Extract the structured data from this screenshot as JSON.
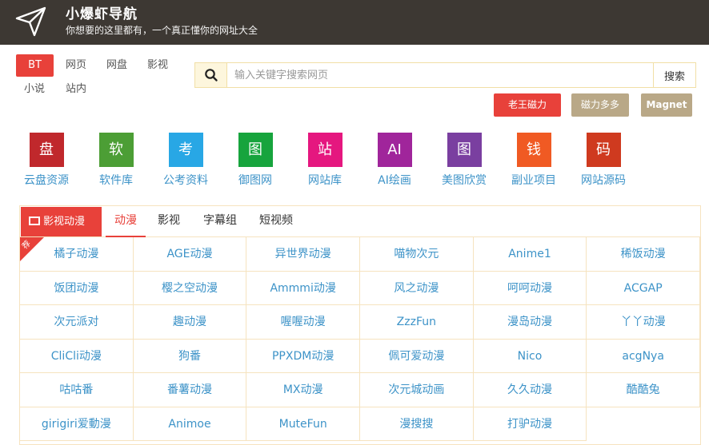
{
  "header": {
    "title": "小爆虾导航",
    "subtitle": "你想要的这里都有，一个真正懂你的网址大全",
    "logo_icon": "paper-plane-icon"
  },
  "search": {
    "tabs": [
      "BT",
      "网页",
      "网盘",
      "影视",
      "小说",
      "站内"
    ],
    "active_tab": "BT",
    "placeholder": "输入关键字搜索网页",
    "value": "",
    "button": "搜索"
  },
  "quick_buttons": [
    {
      "label": "老王磁力",
      "color": "#e8413a"
    },
    {
      "label": "磁力多多",
      "color": "#b9a887"
    },
    {
      "label": "Magnet",
      "color": "#b9a887"
    }
  ],
  "categories": [
    {
      "glyph": "盘",
      "label": "云盘资源",
      "color": "#c0282c"
    },
    {
      "glyph": "软",
      "label": "软件库",
      "color": "#4c9e35"
    },
    {
      "glyph": "考",
      "label": "公考资料",
      "color": "#28a7e5"
    },
    {
      "glyph": "图",
      "label": "御图网",
      "color": "#17a43d"
    },
    {
      "glyph": "站",
      "label": "网站库",
      "color": "#e5177f"
    },
    {
      "glyph": "AI",
      "label": "AI绘画",
      "color": "#a0259b"
    },
    {
      "glyph": "图",
      "label": "美图欣赏",
      "color": "#7a3fa0"
    },
    {
      "glyph": "钱",
      "label": "副业项目",
      "color": "#f05a23"
    },
    {
      "glyph": "码",
      "label": "网站源码",
      "color": "#cf3a1f"
    }
  ],
  "panel": {
    "category": "影视动漫",
    "tabs": [
      "动漫",
      "影视",
      "字幕组",
      "短视频"
    ],
    "active_tab": "动漫",
    "ribbon": "荐",
    "links": [
      [
        "橘子动漫",
        "AGE动漫",
        "异世界动漫",
        "喵物次元",
        "Anime1",
        "稀饭动漫"
      ],
      [
        "饭团动漫",
        "樱之空动漫",
        "Ammmi动漫",
        "风之动漫",
        "呵呵动漫",
        "ACGAP"
      ],
      [
        "次元派对",
        "趣动漫",
        "喔喔动漫",
        "ZzzFun",
        "漫岛动漫",
        "丫丫动漫"
      ],
      [
        "CliCli动漫",
        "狗番",
        "PPXDM动漫",
        "佩可爱动漫",
        "Nico",
        "acgNya"
      ],
      [
        "咕咕番",
        "番薯动漫",
        "MX动漫",
        "次元城动画",
        "久久动漫",
        "酷酷兔"
      ],
      [
        "girigiri爱動漫",
        "Animoe",
        "MuteFun",
        "漫搜搜",
        "打驴动漫",
        ""
      ]
    ]
  }
}
